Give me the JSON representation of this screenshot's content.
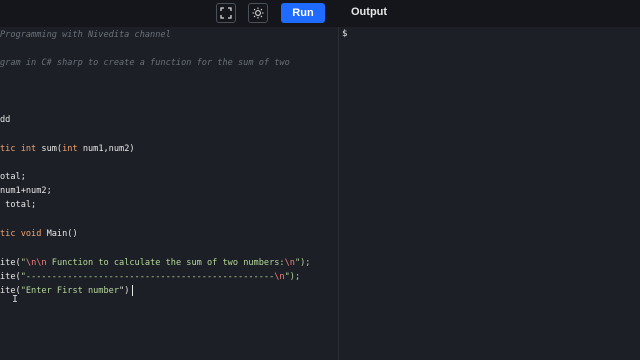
{
  "toolbar": {
    "fullscreen_icon": "fullscreen-icon",
    "theme_icon": "sun-icon",
    "run_label": "Run",
    "output_label": "Output"
  },
  "editor": {
    "comment_1": "Programming with Nivedita channel",
    "comment_2": "gram in C# sharp to create a function for the sum of two",
    "line_dd": "dd",
    "sum_kw1": "tic ",
    "sum_kw2": "int",
    "sum_name": " sum(",
    "sum_kw3": "int",
    "sum_rest": " num1,num2)",
    "total_1": "otal;",
    "total_2": "num1+num2;",
    "total_3": " total;",
    "main_kw": "tic ",
    "main_void": "void",
    "main_rest": " Main()",
    "w1_pre": "ite(",
    "w1_q": "\"",
    "w1_esc1": "\\n\\n",
    "w1_text": " Function to calculate the sum of two numbers:",
    "w1_esc2": "\\n",
    "w1_end": "\");",
    "w2_pre": "ite(",
    "w2_q": "\"",
    "w2_dash": "------------------------------------------------",
    "w2_esc": "\\n",
    "w2_end": "\");",
    "w3_pre": "ite(",
    "w3_str": "\"Enter First number",
    "w3_end": "\")"
  },
  "output": {
    "prompt": "$"
  },
  "colors": {
    "accent": "#1f6bff",
    "keyword": "#f2a36f",
    "string": "#b5d79a",
    "escape": "#f08080",
    "comment": "#6b707a"
  }
}
